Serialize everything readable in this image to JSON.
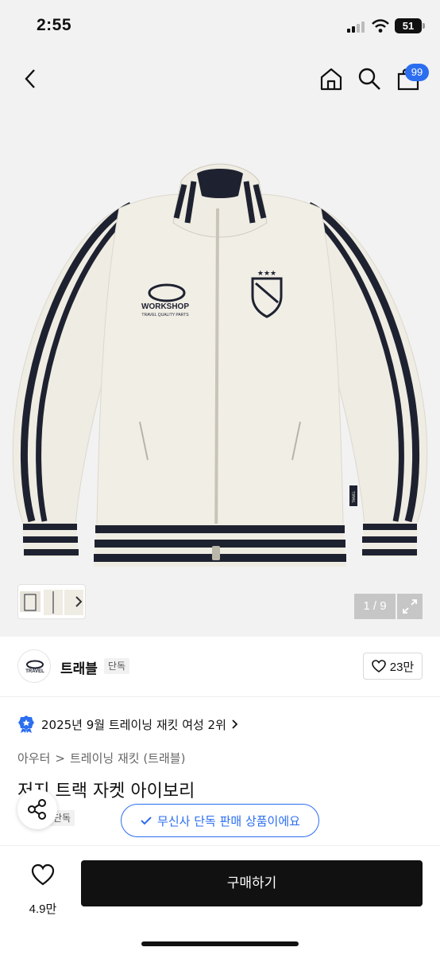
{
  "status_bar": {
    "time": "2:55",
    "battery": "51"
  },
  "header": {
    "cart_count": "99"
  },
  "gallery": {
    "counter": "1 / 9"
  },
  "jacket_graphics": {
    "chest_logo": "WORKSHOP",
    "chest_sub": "TRAVEL QUALITY PARTS",
    "cuff_label": "TRAVEL"
  },
  "brand": {
    "name": "트래블",
    "tag": "단독",
    "logo_text": "TRAVEL",
    "likes": "23만"
  },
  "ranking": {
    "text": "2025년 9월 트레이닝 재킷 여성 2위"
  },
  "breadcrumb": {
    "level1": "아우터",
    "sep": ">",
    "level2": "트레이닝 재킷 (트래블)"
  },
  "product": {
    "title": "저지 트랙 자켓 아이보리",
    "tag": "단독"
  },
  "exclusive_notice": "무신사 단독 판매 상품이에요",
  "bottom": {
    "wish_count": "4.9만",
    "buy_label": "구매하기"
  },
  "colors": {
    "accent": "#2b6ef0",
    "ivory": "#efece3",
    "navy": "#1e2230",
    "hero_bg": "#f2f2f2"
  }
}
